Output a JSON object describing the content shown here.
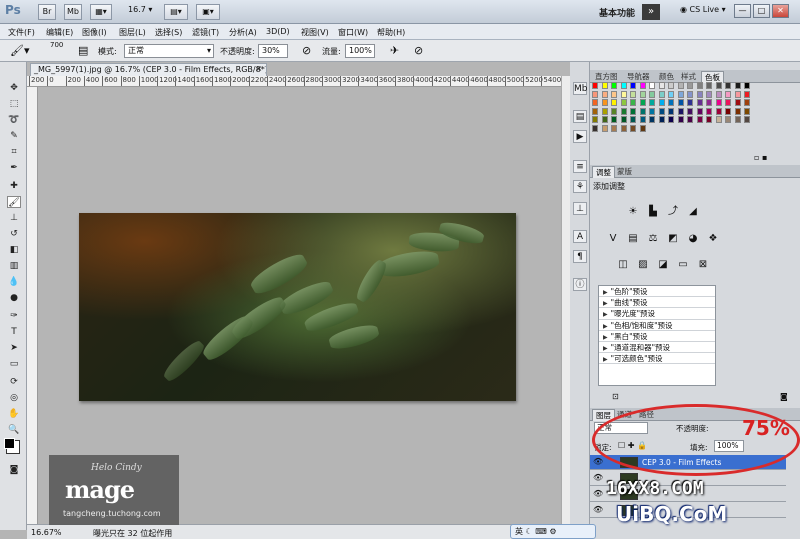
{
  "app": {
    "logo": "Ps",
    "title_buttons": [
      "Br",
      "Mb"
    ],
    "zoom": "16.7",
    "workspace": "基本功能",
    "workspace_arrow": "»",
    "cslive": "CS Live",
    "window_buttons": [
      "—",
      "□",
      "✕"
    ]
  },
  "menu": [
    "文件(F)",
    "编辑(E)",
    "图像(I)",
    "图层(L)",
    "选择(S)",
    "滤镜(T)",
    "分析(A)",
    "3D(D)",
    "视图(V)",
    "窗口(W)",
    "帮助(H)"
  ],
  "options": {
    "brush_size": "700",
    "mode_label": "模式:",
    "mode_value": "正常",
    "opacity_label": "不透明度:",
    "opacity_value": "30%",
    "flow_label": "流量:",
    "flow_value": "100%"
  },
  "document": {
    "tab_title": "_MG_5997(1).jpg @ 16.7% (CEP 3.0 - Film Effects, RGB/8*)",
    "close": "×",
    "ruler_ticks": [
      "200",
      "0",
      "200",
      "400",
      "600",
      "800",
      "1000",
      "1200",
      "1400",
      "1600",
      "1800",
      "2000",
      "2200",
      "2400",
      "2600",
      "2800",
      "3000",
      "3200",
      "3400",
      "3600",
      "3800",
      "4000",
      "4200",
      "4400",
      "4600",
      "4800",
      "5000",
      "5200",
      "5400"
    ]
  },
  "status": {
    "zoom": "16.67%",
    "info": "曝光只在 32 位起作用"
  },
  "watermark_left": {
    "script": "Helo Cindy",
    "main": "mage",
    "url": "tangcheng.tuchong.com"
  },
  "panels": {
    "color_tabs": [
      "直方图",
      "导航器",
      "颜色",
      "样式",
      "色板"
    ],
    "adjust_tabs": [
      "调整",
      "蒙版"
    ],
    "adjust_title": "添加调整",
    "presets": [
      "\"色阶\"预设",
      "\"曲线\"预设",
      "\"曝光度\"预设",
      "\"色相/饱和度\"预设",
      "\"黑白\"预设",
      "\"通道混和器\"预设",
      "\"可选颜色\"预设"
    ],
    "layer_tabs": [
      "图层",
      "通道",
      "路径"
    ],
    "blend_mode": "正常",
    "opacity_label": "不透明度:",
    "opacity_value": "75%",
    "lock_label": "锁定:",
    "fill_label": "填充:",
    "fill_value": "100%",
    "active_layer": "CEP 3.0 - Film Effects"
  },
  "watermark_right": {
    "line1": "16XX8.COM",
    "line2": "UiBQ.CoM"
  },
  "ime": "英"
}
